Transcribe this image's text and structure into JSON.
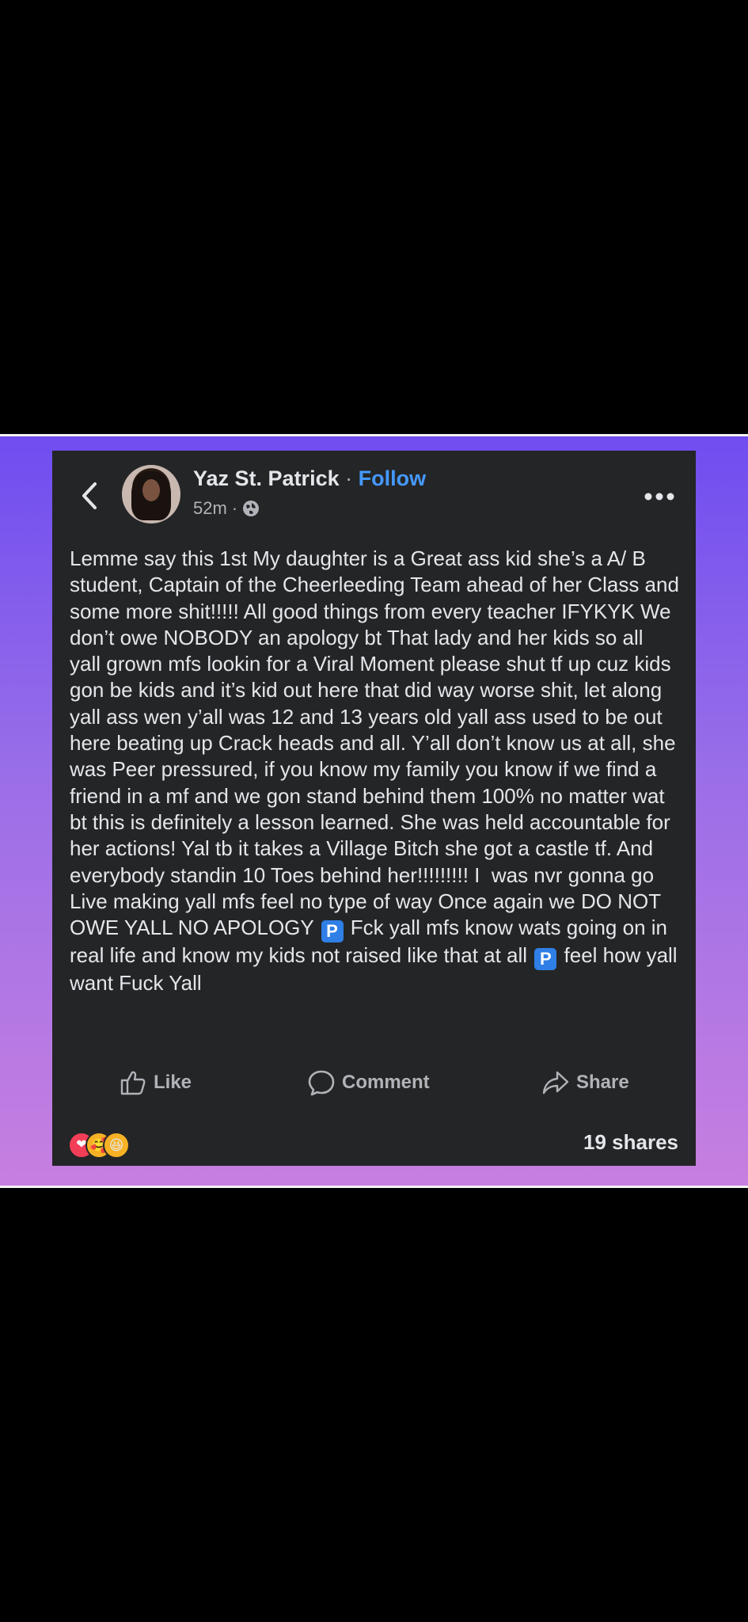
{
  "post": {
    "author": "Yaz St. Patrick",
    "separator": " · ",
    "follow_label": "Follow",
    "time": "52m",
    "meta_separator": "·",
    "text_parts": [
      "Lemme say this 1st My daughter is a Great ass kid she’s a A/ B student, Captain of the Cheerleeding Team ahead of her Class and some more shit!!!!! All good things from every teacher IFYKYK We don’t owe NOBODY an apology bt That lady and her kids so all yall grown mfs lookin for a Viral Moment please shut tf up cuz kids gon be kids and it’s kid out here that did way worse shit, let along yall ass wen y’all was 12 and 13 years old yall ass used to be out here beating up Crack heads and all. Y’all don’t know us at all, she was Peer pressured, if you know my family you know if we find a friend in a mf and we gon stand behind them 100% no matter wat bt this is definitely a lesson learned. She was held accountable for her actions! Yal tb it takes a Village Bitch she got a castle tf. And everybody standin 10 Toes behind her!!!!!!!!! I  was nvr gonna go Live making yall mfs feel no type of way Once again we DO NOT OWE YALL NO APOLOGY ",
      " Fck yall mfs know wats going on in real life and know my kids not raised like that at all ",
      " feel how yall want Fuck Yall"
    ],
    "badge_letter": "P"
  },
  "actions": {
    "like_label": "Like",
    "comment_label": "Comment",
    "share_label": "Share"
  },
  "footer": {
    "shares": "19 shares",
    "reactions": [
      "love",
      "care",
      "haha"
    ]
  },
  "colors": {
    "card_bg": "#242526",
    "follow": "#4599ff",
    "muted": "#b0b3b8",
    "text": "#e4e6eb",
    "gradient_top": "#6f4df0",
    "gradient_bottom": "#c77fe0"
  }
}
